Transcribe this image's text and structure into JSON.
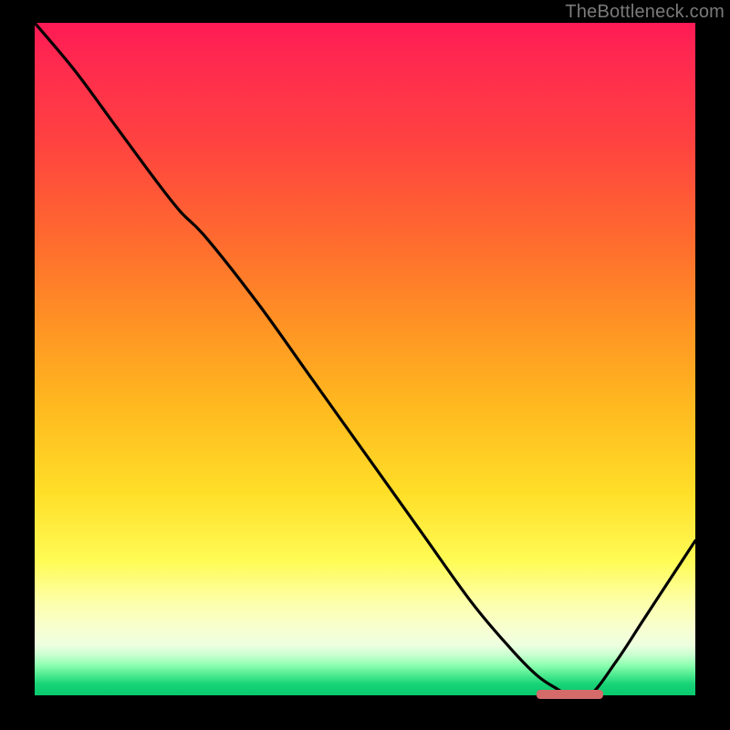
{
  "watermark": {
    "text": "TheBottleneck.com"
  },
  "colors": {
    "curve_stroke": "#000000",
    "marker_fill": "#d46a6a"
  },
  "chart_data": {
    "type": "line",
    "title": "",
    "xlabel": "",
    "ylabel": "",
    "xlim": [
      0,
      100
    ],
    "ylim": [
      0,
      100
    ],
    "grid": false,
    "legend": false,
    "series": [
      {
        "name": "bottleneck-curve",
        "x": [
          0,
          6,
          12,
          18,
          22,
          26,
          34,
          42,
          50,
          58,
          66,
          72,
          76,
          79,
          81,
          84,
          88,
          92,
          96,
          100
        ],
        "y": [
          100,
          93,
          85,
          77,
          72,
          68,
          58,
          47,
          36,
          25,
          14,
          7,
          3,
          1,
          0,
          0,
          5,
          11,
          17,
          23
        ]
      }
    ],
    "annotations": [
      {
        "name": "valley-marker",
        "x_start": 76,
        "x_end": 86,
        "y": 0
      }
    ]
  }
}
